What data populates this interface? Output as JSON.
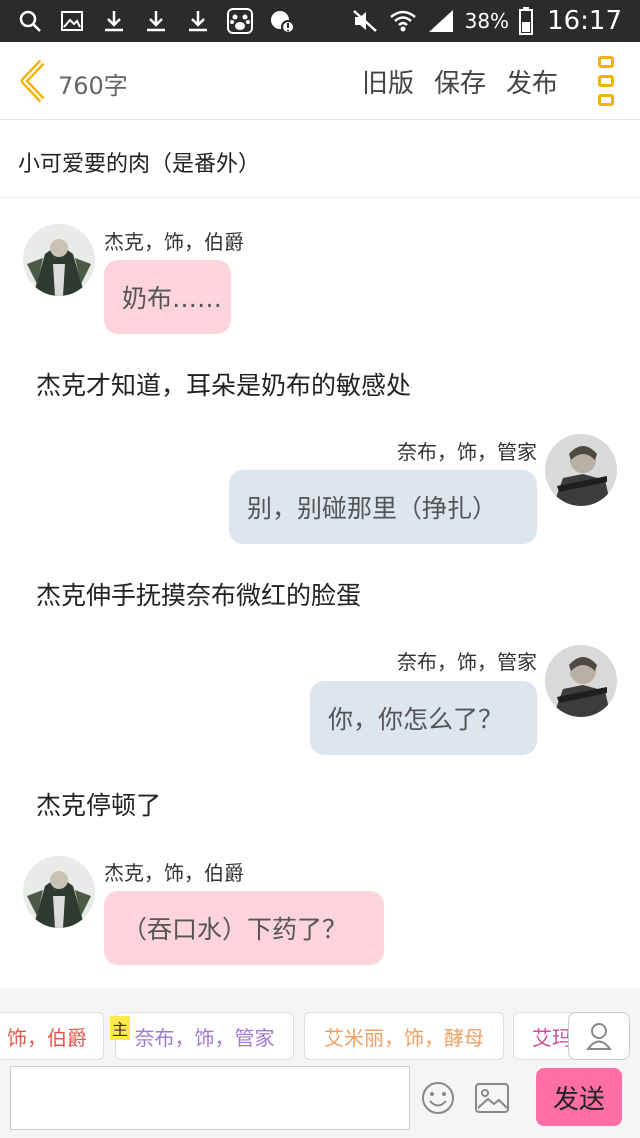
{
  "status_bar": {
    "battery": "38%",
    "time": "16:17"
  },
  "topbar": {
    "word_count": "760字",
    "old_version": "旧版",
    "save": "保存",
    "publish": "发布"
  },
  "story_title": "小可爱要的肉（是番外）",
  "messages": [
    {
      "type": "bubble",
      "side": "left",
      "speaker": "杰克，饰，伯爵",
      "text": "奶布……"
    },
    {
      "type": "narration",
      "text": "杰克才知道，耳朵是奶布的敏感处"
    },
    {
      "type": "bubble",
      "side": "right",
      "speaker": "奈布，饰，管家",
      "text": "别，别碰那里（挣扎）"
    },
    {
      "type": "narration",
      "text": "杰克伸手抚摸奈布微红的脸蛋"
    },
    {
      "type": "bubble",
      "side": "right",
      "speaker": "奈布，饰，管家",
      "text": "你，你怎么了？"
    },
    {
      "type": "narration",
      "text": "杰克停顿了"
    },
    {
      "type": "bubble",
      "side": "left",
      "speaker": "杰克，饰，伯爵",
      "text": "（吞口水）下药了？"
    }
  ],
  "characters": [
    {
      "label": "饰，伯爵",
      "color": "#e05a4a"
    },
    {
      "label": "奈布，饰，管家",
      "color": "#a07ad0"
    },
    {
      "label": "艾米丽，饰，酵母",
      "color": "#f0a060"
    },
    {
      "label": "艾玛",
      "color": "#d04aa0"
    }
  ],
  "host_badge": "主",
  "input": {
    "placeholder": ""
  },
  "send_label": "发送",
  "colors": {
    "pink_bubble": "#fdd3dc",
    "blue_bubble": "#dde5ee",
    "send": "#ff6fa5",
    "accent_yellow": "#f0b400"
  }
}
